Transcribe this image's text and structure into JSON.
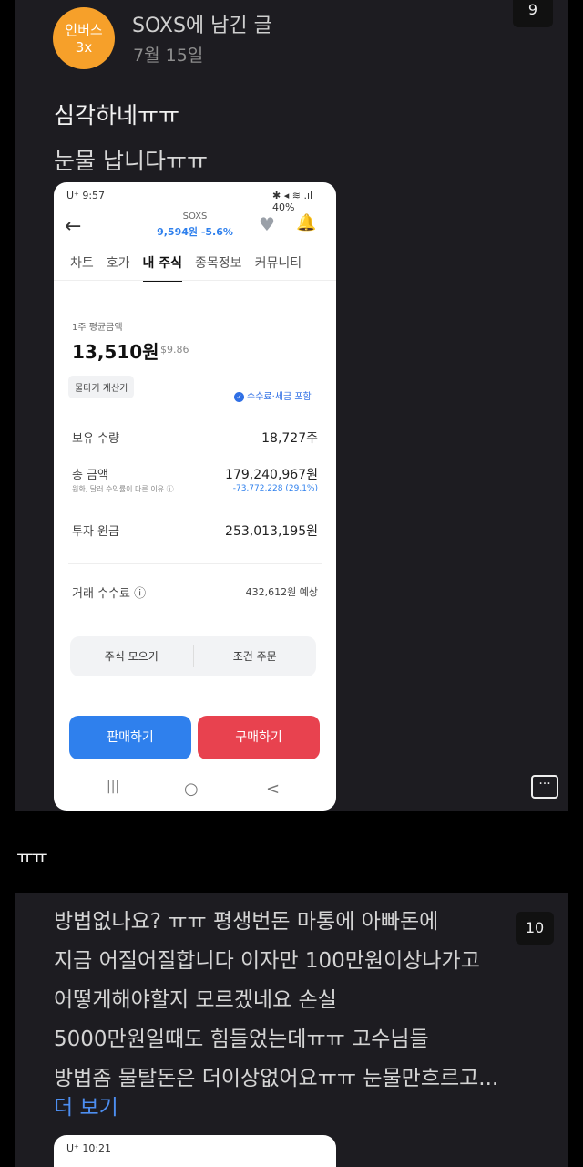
{
  "post1": {
    "avatar_line1": "인버스",
    "avatar_line2": "3x",
    "author": "SOXS에 남긴 글",
    "date": "7월 15일",
    "page_badge": "9",
    "line1": "심각하네ㅠㅠ",
    "line2": "눈물 납니다ㅠㅠ"
  },
  "phone": {
    "status_time": "U⁺ 9:57",
    "status_right": "40%",
    "ticker": "SOXS",
    "price": "9,594원 -5.6%",
    "tabs": [
      "차트",
      "호가",
      "내 주식",
      "종목정보",
      "커뮤니티"
    ],
    "avg_label": "1주 평균금액",
    "avg_krw": "13,510원",
    "avg_usd": "$9.86",
    "calc_button": "물타기 계산기",
    "fee_note": "수수료·세금 포함",
    "holding_label": "보유 수량",
    "holding_value": "18,727주",
    "total_label": "총 금액",
    "total_value": "179,240,967원",
    "total_sub": "원화, 달러 수익률이 다른 이유 ⓘ",
    "total_change": "-73,772,228 (29.1%)",
    "principal_label": "투자 원금",
    "principal_value": "253,013,195원",
    "fee_label": "거래 수수료 ⓘ",
    "fee_value": "432,612원 예상",
    "collect_button": "주식 모으기",
    "condition_button": "조건 주문",
    "sell_button": "판매하기",
    "buy_button": "구매하기",
    "nav_recent": "|||",
    "nav_home": "○",
    "nav_back": "<"
  },
  "reply": {
    "text": "ㅠㅠ"
  },
  "post2": {
    "page_badge": "10",
    "lines": [
      "방법없나요? ㅠㅠ  평생번돈  마통에  아빠돈에",
      "지금  어질어질합니다 이자만 100만원이상나가고",
      "어떻게해야할지 모르겠네요 손실",
      "5000만원일때도 힘들었는데ㅠㅠ  고수님들",
      "방법좀 물탈돈은 더이상없어요ㅠㅠ 눈물만흐르고..."
    ],
    "more_link": "더 보기",
    "phone2_time": "U⁺ 10:21"
  },
  "colors": {
    "avatar": "#f6a02a",
    "sell": "#2f80ed",
    "buy": "#e8424f",
    "link": "#4d8ef0"
  }
}
